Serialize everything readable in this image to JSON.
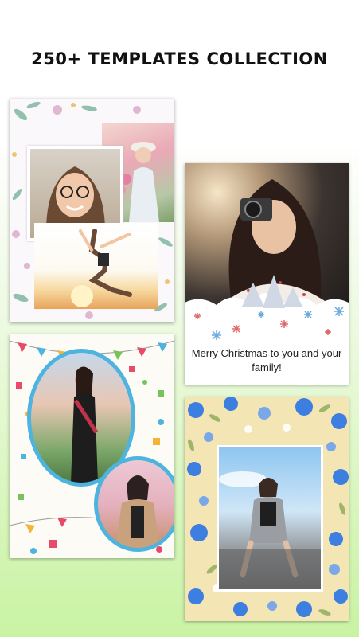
{
  "header": {
    "title": "250+ TEMPLATES COLLECTION"
  },
  "cards": [
    {
      "name": "floral-collage-template"
    },
    {
      "name": "christmas-template",
      "message": "Merry Christmas to you and your family!"
    },
    {
      "name": "party-template"
    },
    {
      "name": "blue-flower-template"
    }
  ],
  "colors": {
    "background_top": "#ffffff",
    "background_bottom": "#c9f3a3",
    "party_ring": "#4db3df",
    "rose_blue": "#3d7fe0",
    "snowflake_red": "#e06a6a",
    "snowflake_blue": "#6aa9e0"
  },
  "icons": [
    "photo-placeholder-icon",
    "snowflake-icon",
    "pine-tree-icon",
    "rose-icon",
    "leaf-icon",
    "bunting-flag-icon"
  ]
}
